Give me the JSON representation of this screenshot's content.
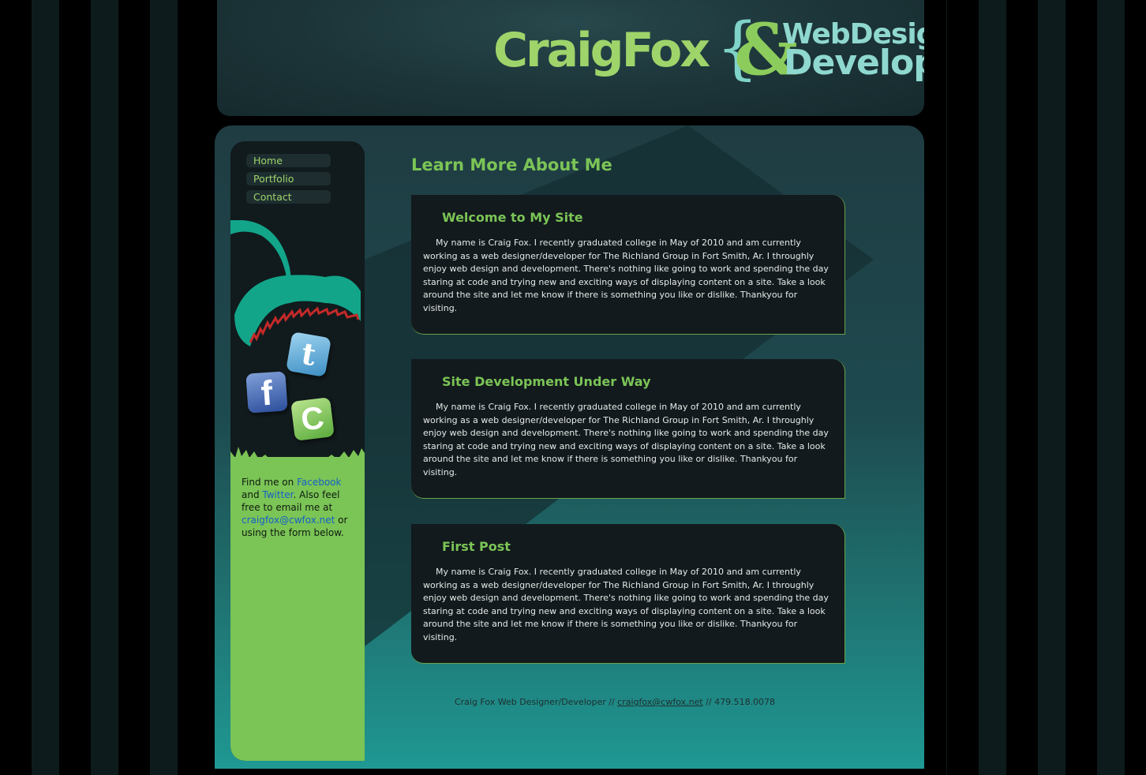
{
  "header": {
    "logo_name": "CraigFox",
    "logo_brace_left": "{",
    "logo_amp": "&",
    "logo_line1": "WebDesigner",
    "logo_line2": "Developer",
    "logo_brace_right": "}"
  },
  "nav": {
    "items": [
      {
        "label": "Home"
      },
      {
        "label": "Portfolio"
      },
      {
        "label": "Contact"
      }
    ]
  },
  "social": {
    "twitter_glyph": "t",
    "facebook_glyph": "f",
    "cwfox_glyph": "C"
  },
  "sidebar_text": {
    "find_me_on": "Find me on ",
    "facebook": "Facebook",
    "and": " and ",
    "twitter": "Twitter",
    "also_feel": ". Also feel free to email me at ",
    "email": "craigfox@cwfox.net",
    "or_using": " or using the form below."
  },
  "main": {
    "title": "Learn More About Me",
    "posts": [
      {
        "title": "Welcome to My Site",
        "body": "My name is Craig Fox. I recently graduated college in May of 2010 and am currently working as a web designer/developer for The Richland Group in Fort Smith, Ar. I throughly enjoy web design and development. There's nothing like going to work and spending the day staring at code and trying new and exciting ways of displaying content on a site. Take a look around the site and let me know if there is something you like or dislike. Thankyou for visiting."
      },
      {
        "title": "Site Development Under Way",
        "body": "My name is Craig Fox. I recently graduated college in May of 2010 and am currently working as a web designer/developer for The Richland Group in Fort Smith, Ar. I throughly enjoy web design and development. There's nothing like going to work and spending the day staring at code and trying new and exciting ways of displaying content on a site. Take a look around the site and let me know if there is something you like or dislike. Thankyou for visiting."
      },
      {
        "title": "First Post",
        "body": "My name is Craig Fox. I recently graduated college in May of 2010 and am currently working as a web designer/developer for The Richland Group in Fort Smith, Ar. I throughly enjoy web design and development. There's nothing like going to work and spending the day staring at code and trying new and exciting ways of displaying content on a site. Take a look around the site and let me know if there is something you like or dislike. Thankyou for visiting."
      }
    ]
  },
  "footer": {
    "prefix": "Craig Fox Web Designer/Developer // ",
    "email": "craigfox@cwfox.net",
    "suffix": " // 479.518.0078"
  },
  "colors": {
    "accent_green": "#7bc456",
    "logo_teal": "#8fd8d0",
    "panel_dark": "#121a1d",
    "link_blue": "#1560c8"
  }
}
